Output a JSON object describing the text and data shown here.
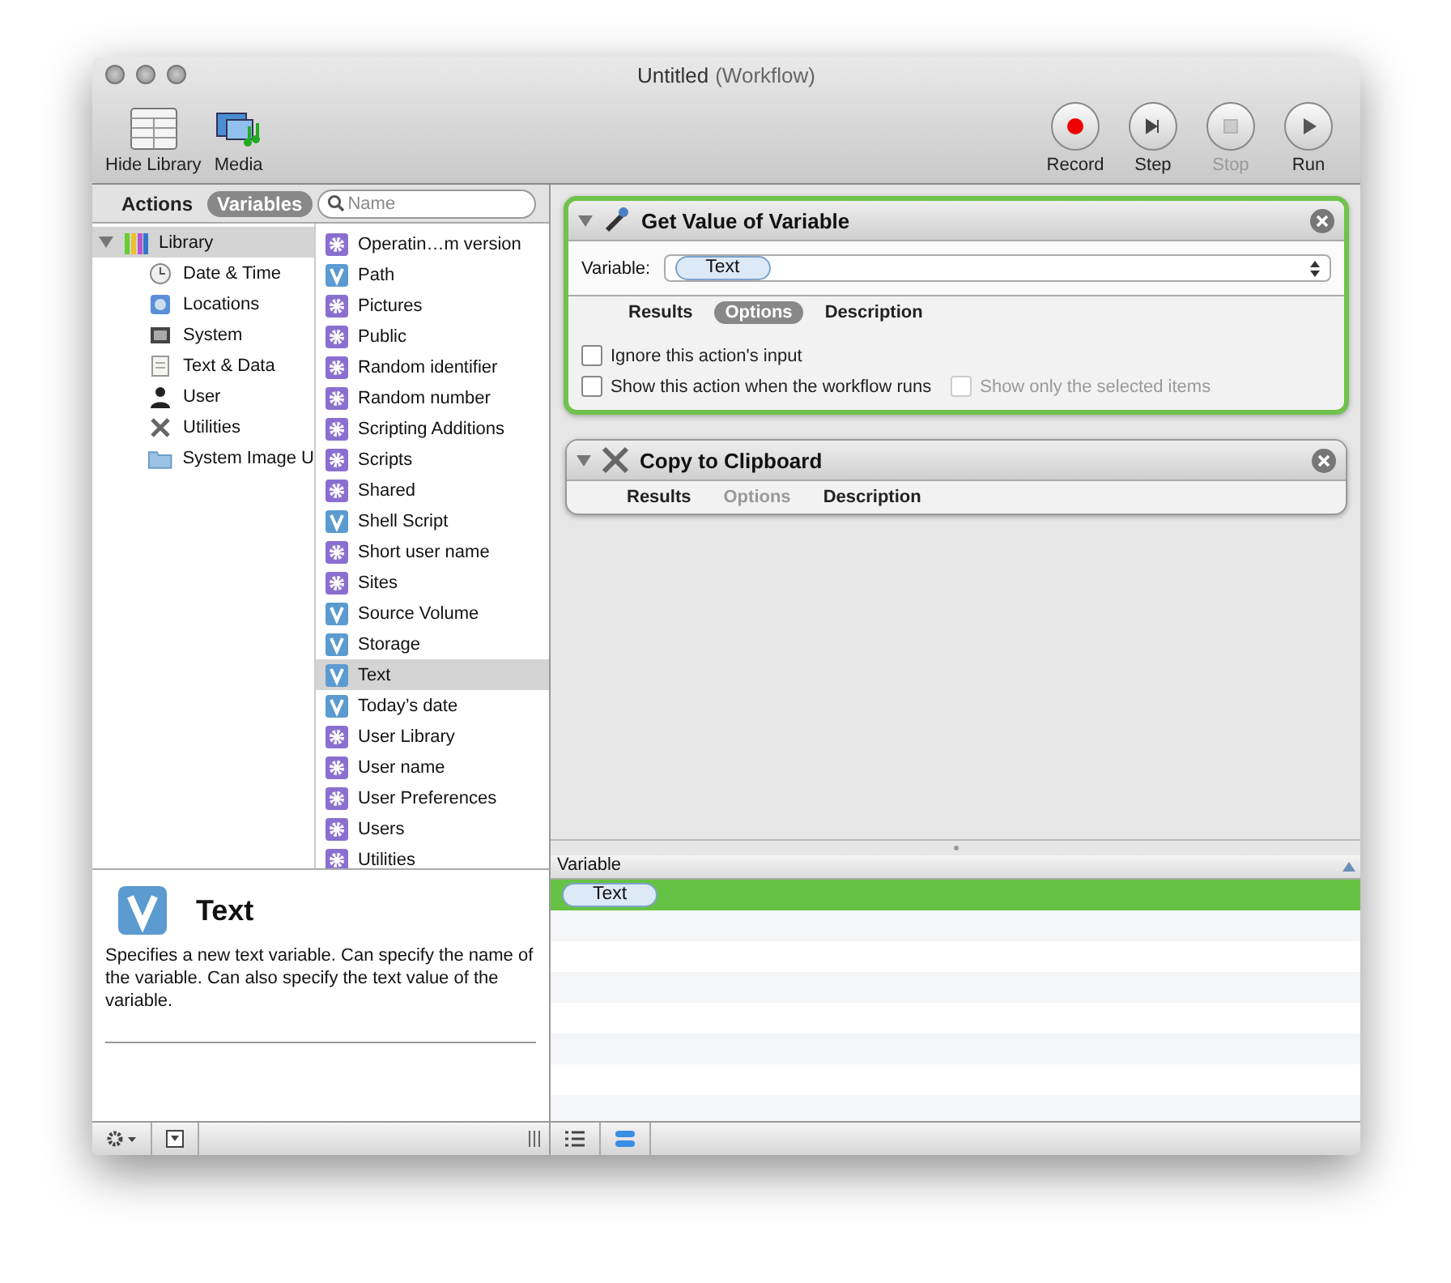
{
  "window": {
    "title": "Untitled",
    "subtitle": "(Workflow)"
  },
  "toolbar": {
    "left": [
      {
        "label": "Hide Library"
      },
      {
        "label": "Media"
      }
    ],
    "right": [
      {
        "label": "Record",
        "disabled": false
      },
      {
        "label": "Step",
        "disabled": false
      },
      {
        "label": "Stop",
        "disabled": true
      },
      {
        "label": "Run",
        "disabled": false
      }
    ]
  },
  "library_header": {
    "tabs": [
      {
        "label": "Actions",
        "selected": false
      },
      {
        "label": "Variables",
        "selected": true
      }
    ],
    "search": {
      "placeholder": "Name"
    }
  },
  "library": {
    "label": "Library",
    "expanded": true,
    "selected": true,
    "children": [
      {
        "label": "Date & Time"
      },
      {
        "label": "Locations"
      },
      {
        "label": "System"
      },
      {
        "label": "Text & Data"
      },
      {
        "label": "User"
      },
      {
        "label": "Utilities"
      },
      {
        "label": "System Image U"
      }
    ]
  },
  "variables": [
    {
      "label": "Operatin…m version",
      "kind": "gear",
      "selected": false
    },
    {
      "label": "Path",
      "kind": "v",
      "selected": false
    },
    {
      "label": "Pictures",
      "kind": "gear",
      "selected": false
    },
    {
      "label": "Public",
      "kind": "gear",
      "selected": false
    },
    {
      "label": "Random identifier",
      "kind": "gear",
      "selected": false
    },
    {
      "label": "Random number",
      "kind": "gear",
      "selected": false
    },
    {
      "label": "Scripting Additions",
      "kind": "gear",
      "selected": false
    },
    {
      "label": "Scripts",
      "kind": "gear",
      "selected": false
    },
    {
      "label": "Shared",
      "kind": "gear",
      "selected": false
    },
    {
      "label": "Shell Script",
      "kind": "v",
      "selected": false
    },
    {
      "label": "Short user name",
      "kind": "gear",
      "selected": false
    },
    {
      "label": "Sites",
      "kind": "gear",
      "selected": false
    },
    {
      "label": "Source Volume",
      "kind": "v",
      "selected": false
    },
    {
      "label": "Storage",
      "kind": "v",
      "selected": false
    },
    {
      "label": "Text",
      "kind": "v",
      "selected": true
    },
    {
      "label": "Today’s date",
      "kind": "v",
      "selected": false
    },
    {
      "label": "User Library",
      "kind": "gear",
      "selected": false
    },
    {
      "label": "User name",
      "kind": "gear",
      "selected": false
    },
    {
      "label": "User Preferences",
      "kind": "gear",
      "selected": false
    },
    {
      "label": "Users",
      "kind": "gear",
      "selected": false
    },
    {
      "label": "Utilities",
      "kind": "gear",
      "selected": false
    }
  ],
  "description": {
    "title": "Text",
    "text": "Specifies a new text variable. Can specify the name of the variable. Can also specify the text value of the variable."
  },
  "workflow": [
    {
      "title": "Get Value of Variable",
      "selected": true,
      "variable": {
        "label": "Variable:",
        "value": "Text"
      },
      "tabs": [
        {
          "label": "Results",
          "selected": false,
          "disabled": false
        },
        {
          "label": "Options",
          "selected": true,
          "disabled": false
        },
        {
          "label": "Description",
          "selected": false,
          "disabled": false
        }
      ],
      "options": [
        {
          "label": "Ignore this action's input",
          "checked": false,
          "disabled": false
        },
        {
          "label": "Show this action when the workflow runs",
          "checked": false,
          "disabled": false
        },
        {
          "label": "Show only the selected items",
          "checked": false,
          "disabled": true
        }
      ]
    },
    {
      "title": "Copy to Clipboard",
      "selected": false,
      "tabs": [
        {
          "label": "Results",
          "selected": false,
          "disabled": false
        },
        {
          "label": "Options",
          "selected": false,
          "disabled": true
        },
        {
          "label": "Description",
          "selected": false,
          "disabled": false
        }
      ]
    }
  ],
  "variable_table": {
    "columns": [
      "Variable"
    ],
    "rows": [
      {
        "value": "Text",
        "selected": true
      }
    ]
  }
}
